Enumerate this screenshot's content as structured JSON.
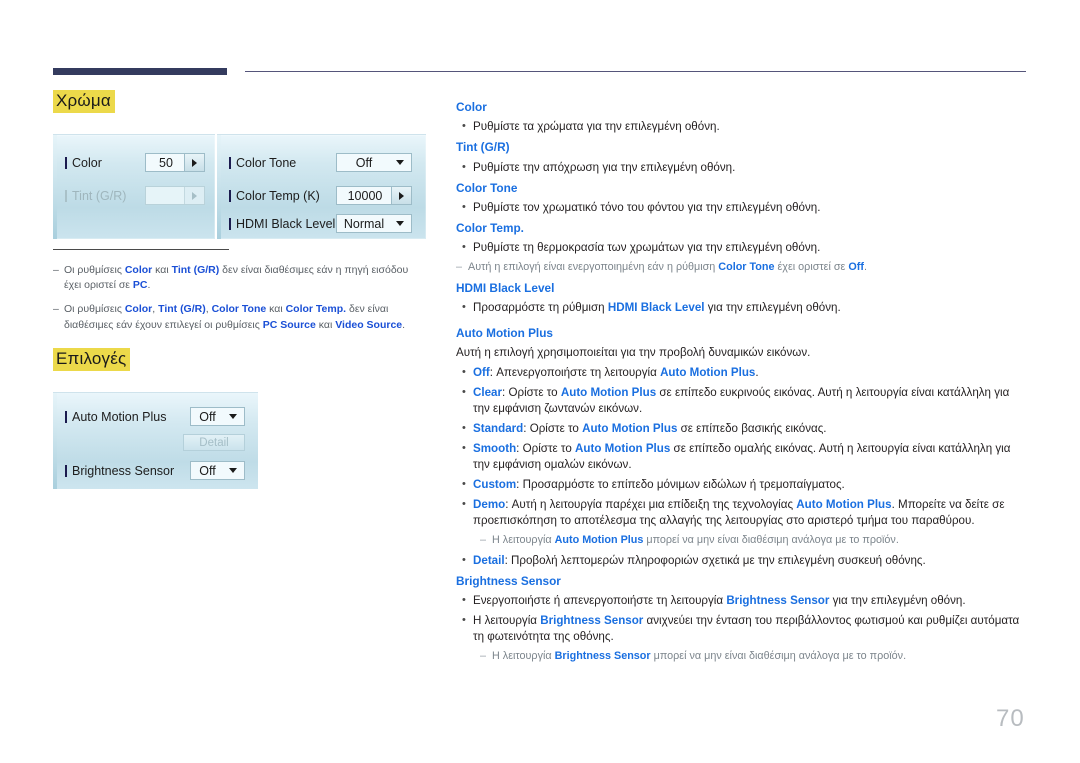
{
  "header": {
    "rule": "decorative-double-rule"
  },
  "left": {
    "section_color_title": "Χρώμα",
    "section_options_title": "Επιλογές",
    "osd_color": {
      "rows_left": [
        {
          "label": "Color",
          "value": "50",
          "widget": "stepper",
          "disabled": false
        },
        {
          "label": "Tint (G/R)",
          "value": "",
          "widget": "stepper",
          "disabled": true
        }
      ],
      "rows_right": [
        {
          "label": "Color Tone",
          "value": "Off",
          "widget": "dropdown",
          "disabled": false
        },
        {
          "label": "Color Temp (K)",
          "value": "10000",
          "widget": "stepper",
          "disabled": false
        },
        {
          "label": "HDMI Black Level",
          "value": "Normal",
          "widget": "dropdown",
          "disabled": false
        }
      ]
    },
    "osd_options": {
      "rows": [
        {
          "label": "Auto Motion Plus",
          "value": "Off",
          "widget": "dropdown"
        },
        {
          "label": "Brightness Sensor",
          "value": "Off",
          "widget": "dropdown"
        }
      ],
      "detail_button": "Detail"
    },
    "notes": [
      {
        "dash": "‒",
        "parts": [
          {
            "t": "Οι ρυθμίσεις ",
            "b": false
          },
          {
            "t": "Color",
            "b": true
          },
          {
            "t": " και ",
            "b": false
          },
          {
            "t": "Tint (G/R)",
            "b": true
          },
          {
            "t": " δεν είναι διαθέσιμες εάν η πηγή εισόδου έχει οριστεί σε ",
            "b": false
          },
          {
            "t": "PC",
            "b": true
          },
          {
            "t": ".",
            "b": false
          }
        ]
      },
      {
        "dash": "‒",
        "parts": [
          {
            "t": "Οι ρυθμίσεις ",
            "b": false
          },
          {
            "t": "Color",
            "b": true
          },
          {
            "t": ", ",
            "b": false
          },
          {
            "t": "Tint (G/R)",
            "b": true
          },
          {
            "t": ", ",
            "b": false
          },
          {
            "t": "Color Tone",
            "b": true
          },
          {
            "t": " και ",
            "b": false
          },
          {
            "t": "Color Temp.",
            "b": true
          },
          {
            "t": " δεν είναι διαθέσιμες εάν έχουν επιλεγεί οι ρυθμίσεις ",
            "b": false
          },
          {
            "t": "PC Source",
            "b": true
          },
          {
            "t": " και ",
            "b": false
          },
          {
            "t": "Video Source",
            "b": true
          },
          {
            "t": ".",
            "b": false
          }
        ]
      }
    ]
  },
  "right": {
    "blocks": [
      {
        "kind": "head",
        "text": "Color"
      },
      {
        "kind": "bullet",
        "parts": [
          {
            "t": "Ρυθμίστε τα χρώματα για την επιλεγμένη οθόνη.",
            "b": false
          }
        ]
      },
      {
        "kind": "head",
        "text": "Tint (G/R)"
      },
      {
        "kind": "bullet",
        "parts": [
          {
            "t": "Ρυθμίστε την απόχρωση για την επιλεγμένη οθόνη.",
            "b": false
          }
        ]
      },
      {
        "kind": "head",
        "text": "Color Tone"
      },
      {
        "kind": "bullet",
        "parts": [
          {
            "t": "Ρυθμίστε τον χρωματικό τόνο του φόντου για την επιλεγμένη οθόνη.",
            "b": false
          }
        ]
      },
      {
        "kind": "head",
        "text": "Color Temp."
      },
      {
        "kind": "bullet",
        "parts": [
          {
            "t": "Ρυθμίστε τη θερμοκρασία των χρωμάτων για την επιλεγμένη οθόνη.",
            "b": false
          }
        ]
      },
      {
        "kind": "subnote",
        "indent": false,
        "dash": "‒",
        "parts": [
          {
            "t": "Αυτή η επιλογή είναι ενεργοποιημένη εάν η ρύθμιση ",
            "b": false
          },
          {
            "t": "Color Tone",
            "b": true
          },
          {
            "t": " έχει οριστεί σε ",
            "b": false
          },
          {
            "t": "Off",
            "b": true
          },
          {
            "t": ".",
            "b": false
          }
        ]
      },
      {
        "kind": "head",
        "text": "HDMI Black Level"
      },
      {
        "kind": "bullet",
        "parts": [
          {
            "t": "Προσαρμόστε τη ρύθμιση ",
            "b": false
          },
          {
            "t": "HDMI Black Level",
            "b": true
          },
          {
            "t": " για την επιλεγμένη οθόνη.",
            "b": false
          }
        ]
      },
      {
        "kind": "head",
        "text": "Auto Motion Plus",
        "spaced": true
      },
      {
        "kind": "para",
        "parts": [
          {
            "t": "Αυτή η επιλογή χρησιμοποιείται για την προβολή δυναμικών εικόνων.",
            "b": false
          }
        ]
      },
      {
        "kind": "bullet",
        "parts": [
          {
            "t": "Off",
            "b": true
          },
          {
            "t": ": Απενεργοποιήστε τη λειτουργία ",
            "b": false
          },
          {
            "t": "Auto Motion Plus",
            "b": true
          },
          {
            "t": ".",
            "b": false
          }
        ]
      },
      {
        "kind": "bullet",
        "parts": [
          {
            "t": "Clear",
            "b": true
          },
          {
            "t": ": Ορίστε το ",
            "b": false
          },
          {
            "t": "Auto Motion Plus",
            "b": true
          },
          {
            "t": " σε επίπεδο ευκρινούς εικόνας. Αυτή η λειτουργία είναι κατάλληλη για την εμφάνιση ζωντανών εικόνων.",
            "b": false
          }
        ]
      },
      {
        "kind": "bullet",
        "parts": [
          {
            "t": "Standard",
            "b": true
          },
          {
            "t": ": Ορίστε το ",
            "b": false
          },
          {
            "t": "Auto Motion Plus",
            "b": true
          },
          {
            "t": " σε επίπεδο βασικής εικόνας.",
            "b": false
          }
        ]
      },
      {
        "kind": "bullet",
        "parts": [
          {
            "t": "Smooth",
            "b": true
          },
          {
            "t": ": Ορίστε το ",
            "b": false
          },
          {
            "t": "Auto Motion Plus",
            "b": true
          },
          {
            "t": " σε επίπεδο ομαλής εικόνας. Αυτή η λειτουργία είναι κατάλληλη για την εμφάνιση ομαλών εικόνων.",
            "b": false
          }
        ]
      },
      {
        "kind": "bullet",
        "parts": [
          {
            "t": "Custom",
            "b": true
          },
          {
            "t": ": Προσαρμόστε το επίπεδο μόνιμων ειδώλων ή τρεμοπαίγματος.",
            "b": false
          }
        ]
      },
      {
        "kind": "bullet",
        "parts": [
          {
            "t": "Demo",
            "b": true
          },
          {
            "t": ": Αυτή η λειτουργία παρέχει μια επίδειξη της τεχνολογίας ",
            "b": false
          },
          {
            "t": "Auto Motion Plus",
            "b": true
          },
          {
            "t": ". Μπορείτε να δείτε σε προεπισκόπηση το αποτέλεσμα της αλλαγής της λειτουργίας στο αριστερό τμήμα του παραθύρου.",
            "b": false
          }
        ]
      },
      {
        "kind": "subnote",
        "indent": true,
        "dash": "‒",
        "parts": [
          {
            "t": "Η λειτουργία ",
            "b": false
          },
          {
            "t": "Auto Motion Plus",
            "b": true
          },
          {
            "t": " μπορεί να μην είναι διαθέσιμη ανάλογα με το προϊόν.",
            "b": false
          }
        ]
      },
      {
        "kind": "bullet",
        "parts": [
          {
            "t": "Detail",
            "b": true
          },
          {
            "t": ": Προβολή λεπτομερών πληροφοριών σχετικά με την επιλεγμένη συσκευή οθόνης.",
            "b": false
          }
        ]
      },
      {
        "kind": "head",
        "text": "Brightness Sensor"
      },
      {
        "kind": "bullet",
        "parts": [
          {
            "t": "Ενεργοποιήστε ή απενεργοποιήστε τη λειτουργία ",
            "b": false
          },
          {
            "t": "Brightness Sensor",
            "b": true
          },
          {
            "t": " για την επιλεγμένη οθόνη.",
            "b": false
          }
        ]
      },
      {
        "kind": "bullet",
        "parts": [
          {
            "t": "Η λειτουργία ",
            "b": false
          },
          {
            "t": "Brightness Sensor",
            "b": true
          },
          {
            "t": " ανιχνεύει την ένταση του περιβάλλοντος φωτισμού και ρυθμίζει αυτόματα τη φωτεινότητα της οθόνης.",
            "b": false
          }
        ]
      },
      {
        "kind": "subnote",
        "indent": true,
        "dash": "‒",
        "parts": [
          {
            "t": "Η λειτουργία ",
            "b": false
          },
          {
            "t": "Brightness Sensor",
            "b": true
          },
          {
            "t": " μπορεί να μην είναι διαθέσιμη ανάλογα με το προϊόν.",
            "b": false
          }
        ]
      }
    ],
    "bullet_glyph": "•"
  },
  "footer": {
    "page_number": "70"
  },
  "colors": {
    "link_blue": "#1a6fe0",
    "note_blue": "#1a4fd6",
    "highlight_yellow": "#ecd94a",
    "rule_navy": "#343b5e",
    "page_num_gray": "#b8bcc0"
  }
}
